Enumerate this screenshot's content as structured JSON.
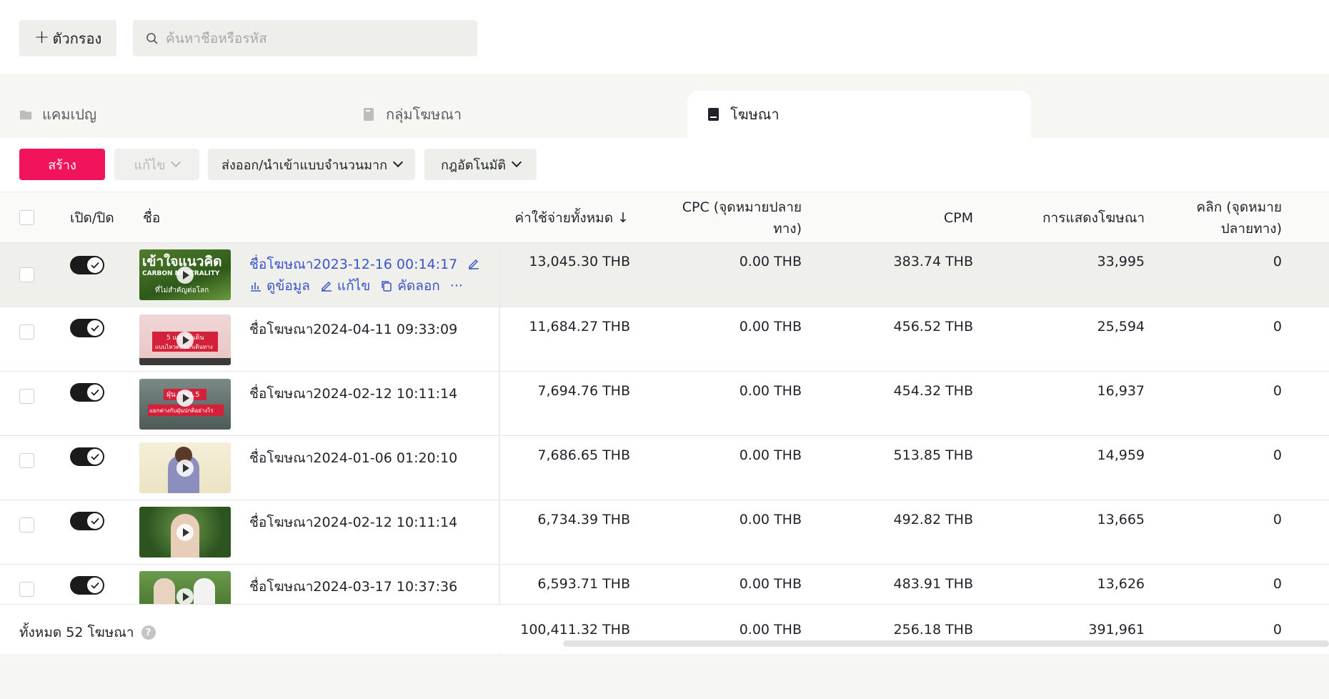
{
  "filter": {
    "label": "ตัวกรอง",
    "search_placeholder": "ค้นหาชื่อหรือรหัส"
  },
  "tabs": [
    {
      "label": "แคมเปญ",
      "icon": "folder-icon"
    },
    {
      "label": "กลุ่มโฆษณา",
      "icon": "ad-group-icon"
    },
    {
      "label": "โฆษณา",
      "icon": "ad-icon",
      "active": true
    }
  ],
  "toolbar": {
    "create": "สร้าง",
    "edit": "แก้ไข",
    "export": "ส่งออก/นำเข้าแบบจำนวนมาก",
    "rules": "กฎอัตโนมัติ"
  },
  "columns": {
    "toggle": "เปิด/ปิด",
    "name": "ชื่อ",
    "spend": "ค่าใช้จ่ายทั้งหมด ↓",
    "cpc_1": "CPC (จุดหมายปลาย",
    "cpc_2": "ทาง)",
    "cpm": "CPM",
    "impressions": "การแสดงโฆษณา",
    "clicks_1": "คลิก (จุดหมาย",
    "clicks_2": "ปลายทาง)"
  },
  "row_actions": {
    "view": "ดูข้อมูล",
    "edit": "แก้ไข",
    "copy": "คัดลอก",
    "more": "···"
  },
  "rows": [
    {
      "name": "ชื่อโฆษณา2023-12-16 00:14:17",
      "spend": "13,045.30 THB",
      "cpc": "0.00 THB",
      "cpm": "383.74 THB",
      "impressions": "33,995",
      "clicks": "0",
      "thumb_text_1": "เข้าใจแนวคิด",
      "thumb_text_2": "CARBON NEUTRALITY",
      "thumb_text_3": "ที่ไม่สำคัญต่อโลก"
    },
    {
      "name": "ชื่อโฆษณา2024-04-11 09:33:09",
      "spend": "11,684.27 THB",
      "cpc": "0.00 THB",
      "cpm": "456.52 THB",
      "impressions": "25,594",
      "clicks": "0",
      "thumb_text_1": "5 แนวคิดเดิน",
      "thumb_text_2": "แบบไหวต่อออกเดินทาง"
    },
    {
      "name": "ชื่อโฆษณา2024-02-12 10:11:14",
      "spend": "7,694.76 THB",
      "cpc": "0.00 THB",
      "cpm": "454.32 THB",
      "impressions": "16,937",
      "clicks": "0",
      "thumb_text_1": "ฝุ่น PM2.5",
      "thumb_text_2": "แยกต่างกับฝุ่นปกติอย่างไร"
    },
    {
      "name": "ชื่อโฆษณา2024-01-06 01:20:10",
      "spend": "7,686.65 THB",
      "cpc": "0.00 THB",
      "cpm": "513.85 THB",
      "impressions": "14,959",
      "clicks": "0"
    },
    {
      "name": "ชื่อโฆษณา2024-02-12 10:11:14",
      "spend": "6,734.39 THB",
      "cpc": "0.00 THB",
      "cpm": "492.82 THB",
      "impressions": "13,665",
      "clicks": "0"
    },
    {
      "name": "ชื่อโฆษณา2024-03-17 10:37:36",
      "spend": "6,593.71 THB",
      "cpc": "0.00 THB",
      "cpm": "483.91 THB",
      "impressions": "13,626",
      "clicks": "0"
    }
  ],
  "totals": {
    "label": "ทั้งหมด 52 โฆษณา",
    "spend": "100,411.32 THB",
    "cpc": "0.00 THB",
    "cpm": "256.18 THB",
    "impressions": "391,961",
    "clicks": "0"
  },
  "colors": {
    "accent": "#f1145a",
    "link": "#3b54c9",
    "toggle_on": "#1b1b1b"
  }
}
